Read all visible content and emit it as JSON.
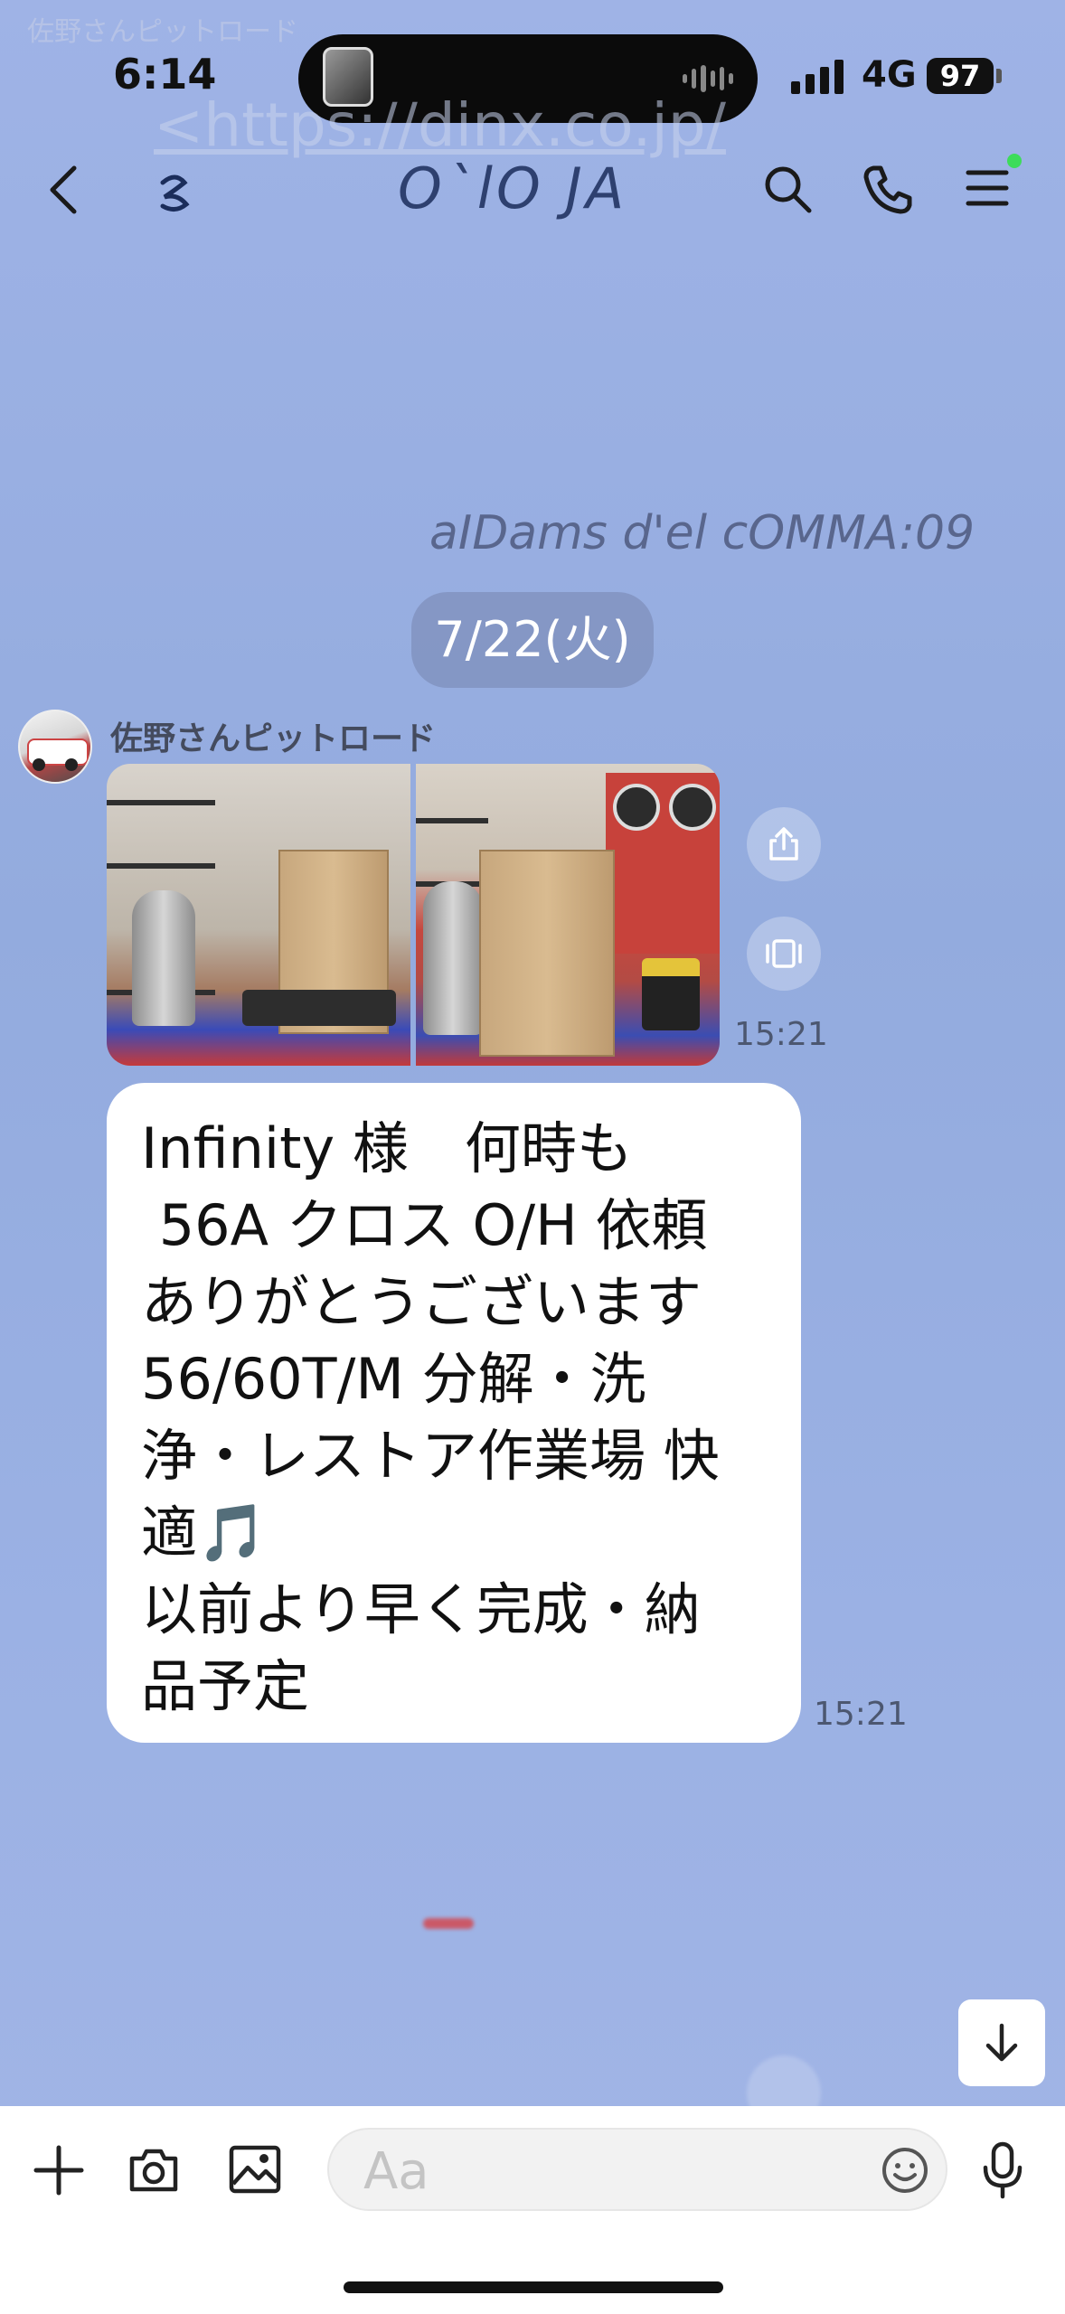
{
  "status_bar": {
    "time": "6:14",
    "network": "4G",
    "battery": "97"
  },
  "header": {
    "title": "O`lO JA"
  },
  "background_ghost": {
    "top_name": "佐野さんピットロード",
    "url": "<https://dinx.co.jp/",
    "scribble": "aIDams d'el cOMMA:09"
  },
  "chat": {
    "date_pill": "7/22(火)",
    "sender_name": "佐野さんピットロード",
    "photos_time": "15:21",
    "message_text": "Infinity 様　何時も\n 56A クロス O/H 依頼\nありがとうございます\n56/60T/M 分解・洗\n浄・レストア作業場 快\n適🎵\n以前より早く完成・納\n品予定",
    "message_time": "15:21"
  },
  "input": {
    "placeholder": "Aa"
  },
  "icons": {
    "back": "chevron-left-icon",
    "search": "search-icon",
    "call": "phone-icon",
    "menu": "menu-icon",
    "share": "share-icon",
    "gallery": "gallery-icon",
    "scroll_down": "arrow-down-icon",
    "add": "plus-icon",
    "camera": "camera-icon",
    "image": "image-icon",
    "emoji": "emoji-icon",
    "mic": "mic-icon"
  },
  "colors": {
    "chat_background": "#9fb3e6",
    "bubble": "#ffffff",
    "online_dot": "#3ddc5a"
  }
}
